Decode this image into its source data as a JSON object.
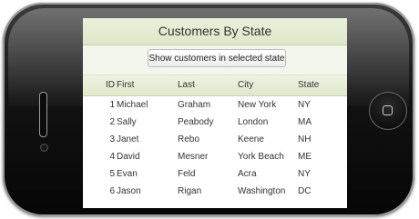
{
  "app": {
    "title": "Customers By State",
    "action_button": "Show customers in selected state"
  },
  "grid": {
    "columns": [
      "ID",
      "First",
      "Last",
      "City",
      "State"
    ],
    "rows": [
      {
        "id": "1",
        "first": "Michael",
        "last": "Graham",
        "city": "New York",
        "state": "NY"
      },
      {
        "id": "2",
        "first": "Sally",
        "last": "Peabody",
        "city": "London",
        "state": "MA"
      },
      {
        "id": "3",
        "first": "Janet",
        "last": "Rebo",
        "city": "Keene",
        "state": "NH"
      },
      {
        "id": "4",
        "first": "David",
        "last": "Mesner",
        "city": "York Beach",
        "state": "ME"
      },
      {
        "id": "5",
        "first": "Evan",
        "last": "Feld",
        "city": "Acra",
        "state": "NY"
      },
      {
        "id": "6",
        "first": "Jason",
        "last": "Rigan",
        "city": "Washington",
        "state": "DC"
      }
    ]
  }
}
